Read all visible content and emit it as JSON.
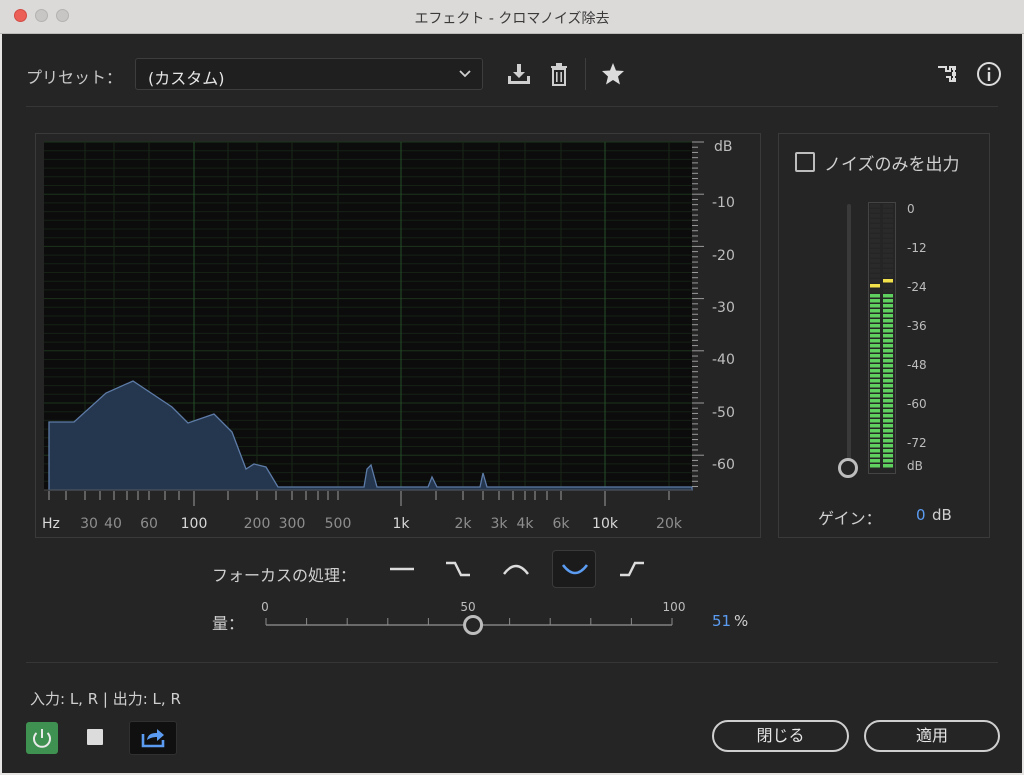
{
  "window": {
    "title": "エフェクト - クロマノイズ除去"
  },
  "toolbar": {
    "preset_label": "プリセット：",
    "preset_value": "(カスタム)",
    "icons": [
      "save-preset-icon",
      "delete-preset-icon",
      "favorite-star-icon",
      "routing-icon",
      "info-icon"
    ]
  },
  "graph": {
    "db_unit": "dB",
    "db_ticks": [
      "-10",
      "-20",
      "-30",
      "-40",
      "-50",
      "-60"
    ],
    "hz_unit": "Hz",
    "freq_labels": [
      "30",
      "40",
      "60",
      "100",
      "200",
      "300",
      "500",
      "1k",
      "2k",
      "3k",
      "4k",
      "6k",
      "10k",
      "20k"
    ]
  },
  "output": {
    "noise_only_label": "ノイズのみを出力",
    "noise_only_checked": false,
    "meter_labels": [
      "0",
      "-12",
      "-24",
      "-36",
      "-48",
      "-60",
      "-72",
      "dB"
    ],
    "gain_label": "ゲイン：",
    "gain_value": "0",
    "gain_unit": "dB"
  },
  "focus": {
    "label": "フォーカスの処理：",
    "options": [
      "flat",
      "high-shelf-down",
      "peak",
      "notch",
      "low-shelf-up"
    ],
    "selected_index": 3
  },
  "amount": {
    "label": "量：",
    "scale": [
      "0",
      "50",
      "100"
    ],
    "value": "51",
    "unit": "%",
    "fraction": 0.51
  },
  "footer": {
    "io_label": "入力: L, R | 出力: L, R",
    "close_label": "閉じる",
    "apply_label": "適用"
  },
  "colors": {
    "accent": "#5b9cf2",
    "power": "#3f9151",
    "meter_green": "#5fcf5f",
    "meter_yellow": "#f2e14a"
  }
}
